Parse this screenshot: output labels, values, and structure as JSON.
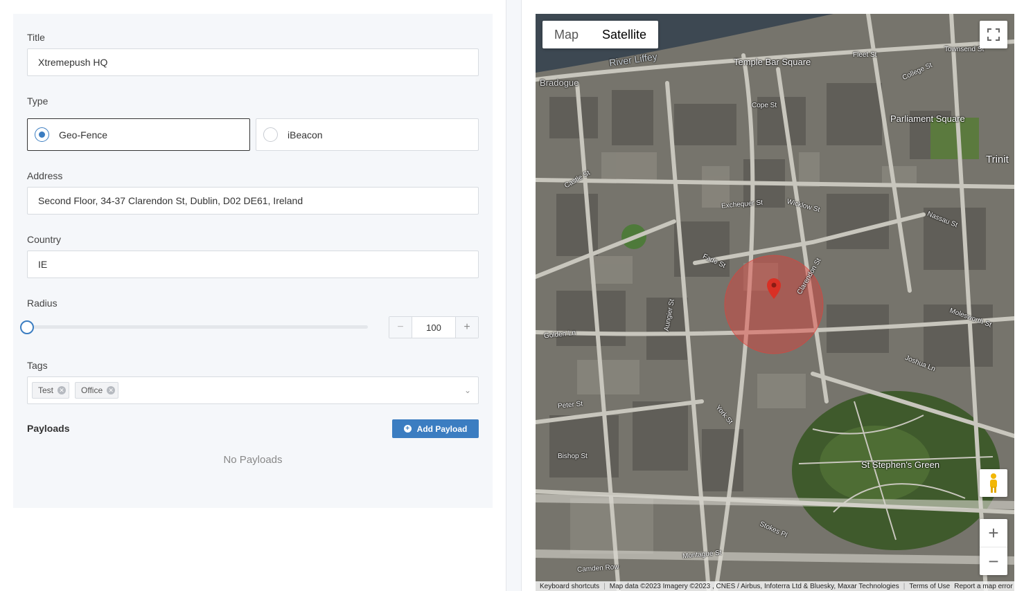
{
  "form": {
    "title_label": "Title",
    "title_value": "Xtremepush HQ",
    "type_label": "Type",
    "type_options": [
      {
        "label": "Geo-Fence",
        "selected": true
      },
      {
        "label": "iBeacon",
        "selected": false
      }
    ],
    "address_label": "Address",
    "address_value": "Second Floor, 34-37 Clarendon St, Dublin, D02 DE61, Ireland",
    "country_label": "Country",
    "country_value": "IE",
    "radius_label": "Radius",
    "radius_value": "100",
    "radius_minus": "−",
    "radius_plus": "+",
    "tags_label": "Tags",
    "tags": [
      "Test",
      "Office"
    ],
    "payloads_title": "Payloads",
    "add_payload_label": "Add Payload",
    "no_payloads": "No Payloads",
    "accent_color": "#3b7dc1"
  },
  "map": {
    "type_buttons": {
      "map": "Map",
      "satellite": "Satellite"
    },
    "active_type": "Satellite",
    "zoom_in": "+",
    "zoom_out": "−",
    "street_labels": {
      "liffey": "River Liffey",
      "temple_bar": "Temple Bar Square",
      "parliament": "Parliament Square",
      "trinity": "Trinit",
      "bradogue": "Bradogue",
      "cope": "Cope St",
      "exchequer": "Exchequer St",
      "wicklow": "Wicklow St",
      "nassau": "Nassau St",
      "castle": "Castle St",
      "fade": "Fade St",
      "golden": "Golden Ln",
      "molesworth": "Molesworth St",
      "joshua": "Joshua Ln",
      "stephens_green": "St Stephen's Green",
      "peter": "Peter St",
      "bishop": "Bishop St",
      "york": "York St",
      "camden": "Camden Row",
      "montague": "Montague St",
      "stokes": "Stokes Pl",
      "townsend": "Townsend St",
      "fleet": "Fleet St",
      "college": "College St",
      "clarendon": "Clarendon St",
      "aungier": "Aungier St"
    },
    "footer": {
      "shortcuts": "Keyboard shortcuts",
      "data": "Map data ©2023 Imagery ©2023 , CNES / Airbus, Infoterra Ltd & Bluesky, Maxar Technologies",
      "terms": "Terms of Use",
      "report": "Report a map error"
    },
    "geofence_color": "#e0413a"
  }
}
